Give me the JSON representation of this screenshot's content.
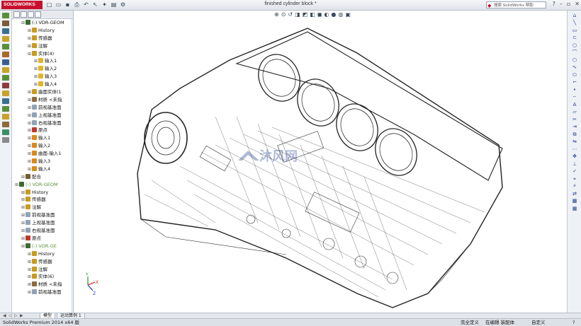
{
  "window": {
    "brand": "SOLIDWORKS",
    "document_title": "finished cylinder block *",
    "search_placeholder": "搜索 SolidWorks 帮助"
  },
  "tree": {
    "items": [
      {
        "label": "(-) VDR-GEOM",
        "level": 1,
        "color": "#3d6b2f"
      },
      {
        "label": "History",
        "level": 2,
        "color": "#c99a1f"
      },
      {
        "label": "传感器",
        "level": 2,
        "color": "#c99a1f"
      },
      {
        "label": "注解",
        "level": 2,
        "color": "#c99a1f"
      },
      {
        "label": "实体(4)",
        "level": 2,
        "color": "#c99a1f"
      },
      {
        "label": "输入1",
        "level": 3,
        "color": "#e0b52a"
      },
      {
        "label": "输入2",
        "level": 3,
        "color": "#e0b52a"
      },
      {
        "label": "输入3",
        "level": 3,
        "color": "#e0b52a"
      },
      {
        "label": "输入4",
        "level": 3,
        "color": "#e0b52a"
      },
      {
        "label": "曲面实体(1",
        "level": 2,
        "color": "#c99a1f"
      },
      {
        "label": "材质 <未指",
        "level": 2,
        "color": "#8a6d3b"
      },
      {
        "label": "前视基准面",
        "level": 2,
        "color": "#8fa3b8"
      },
      {
        "label": "上视基准面",
        "level": 2,
        "color": "#8fa3b8"
      },
      {
        "label": "右视基准面",
        "level": 2,
        "color": "#8fa3b8"
      },
      {
        "label": "原点",
        "level": 2,
        "color": "#c0392b"
      },
      {
        "label": "输入1",
        "level": 2,
        "color": "#d98a1c"
      },
      {
        "label": "输入2",
        "level": 2,
        "color": "#d98a1c"
      },
      {
        "label": "曲面-输入1",
        "level": 2,
        "color": "#d98a1c"
      },
      {
        "label": "输入3",
        "level": 2,
        "color": "#d98a1c"
      },
      {
        "label": "输入4",
        "level": 2,
        "color": "#d98a1c"
      },
      {
        "label": "配合",
        "level": 1,
        "color": "#7a5c2e"
      },
      {
        "label": "(-) VDR-GEOM",
        "level": 0,
        "color": "#3d6b2f",
        "faded": true
      },
      {
        "label": "History",
        "level": 1,
        "color": "#c99a1f"
      },
      {
        "label": "传感器",
        "level": 1,
        "color": "#c99a1f"
      },
      {
        "label": "注解",
        "level": 1,
        "color": "#c99a1f"
      },
      {
        "label": "前视基准面",
        "level": 1,
        "color": "#8fa3b8"
      },
      {
        "label": "上视基准面",
        "level": 1,
        "color": "#8fa3b8"
      },
      {
        "label": "右视基准面",
        "level": 1,
        "color": "#8fa3b8"
      },
      {
        "label": "原点",
        "level": 1,
        "color": "#c0392b"
      },
      {
        "label": "(-) VDR-GE",
        "level": 1,
        "color": "#3d6b2f",
        "faded": true
      },
      {
        "label": "History",
        "level": 2,
        "color": "#c99a1f"
      },
      {
        "label": "传感器",
        "level": 2,
        "color": "#c99a1f"
      },
      {
        "label": "注解",
        "level": 2,
        "color": "#c99a1f"
      },
      {
        "label": "实体(6)",
        "level": 2,
        "color": "#c99a1f"
      },
      {
        "label": "材质 <未指",
        "level": 2,
        "color": "#8a6d3b"
      },
      {
        "label": "前视基准面",
        "level": 2,
        "color": "#8fa3b8"
      }
    ]
  },
  "bottom_tabs": {
    "model": "模型",
    "motion": "运动算例 1"
  },
  "status": {
    "app": "SolidWorks Premium 2014 x64 版",
    "defined": "完全定义",
    "editing": "在编辑 装配体",
    "custom": "自定义"
  },
  "watermark": "沐风网",
  "colors": {
    "brand_red": "#c8102e",
    "axis_x": "#d42020",
    "axis_y": "#1aa01a",
    "axis_z": "#1a3cd4"
  }
}
